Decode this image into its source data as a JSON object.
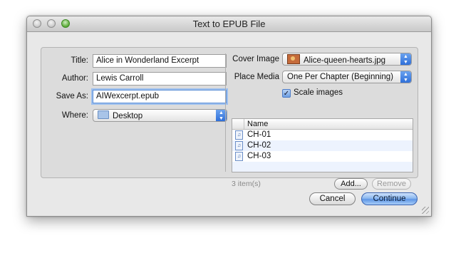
{
  "window": {
    "title": "Text to EPUB File"
  },
  "left": {
    "title_label": "Title:",
    "title_value": "Alice in Wonderland Excerpt",
    "author_label": "Author:",
    "author_value": "Lewis Carroll",
    "saveas_label": "Save As:",
    "saveas_value": "AIWexcerpt.epub",
    "where_label": "Where:",
    "where_value": "Desktop"
  },
  "right": {
    "cover_label": "Cover Image",
    "cover_value": "Alice-queen-hearts.jpg",
    "place_label": "Place Media",
    "place_value": "One Per Chapter (Beginning)",
    "scale_label": "Scale images",
    "scale_checked": true,
    "list_header": "Name",
    "items": [
      {
        "name": "CH-01"
      },
      {
        "name": "CH-02"
      },
      {
        "name": "CH-03"
      }
    ],
    "count_text": "3 item(s)",
    "add_label": "Add...",
    "remove_label": "Remove"
  },
  "buttons": {
    "cancel": "Cancel",
    "continue": "Continue"
  },
  "icons": {
    "check": "✓",
    "arrows_up": "▲",
    "arrows_down": "▼",
    "file": "♫"
  }
}
